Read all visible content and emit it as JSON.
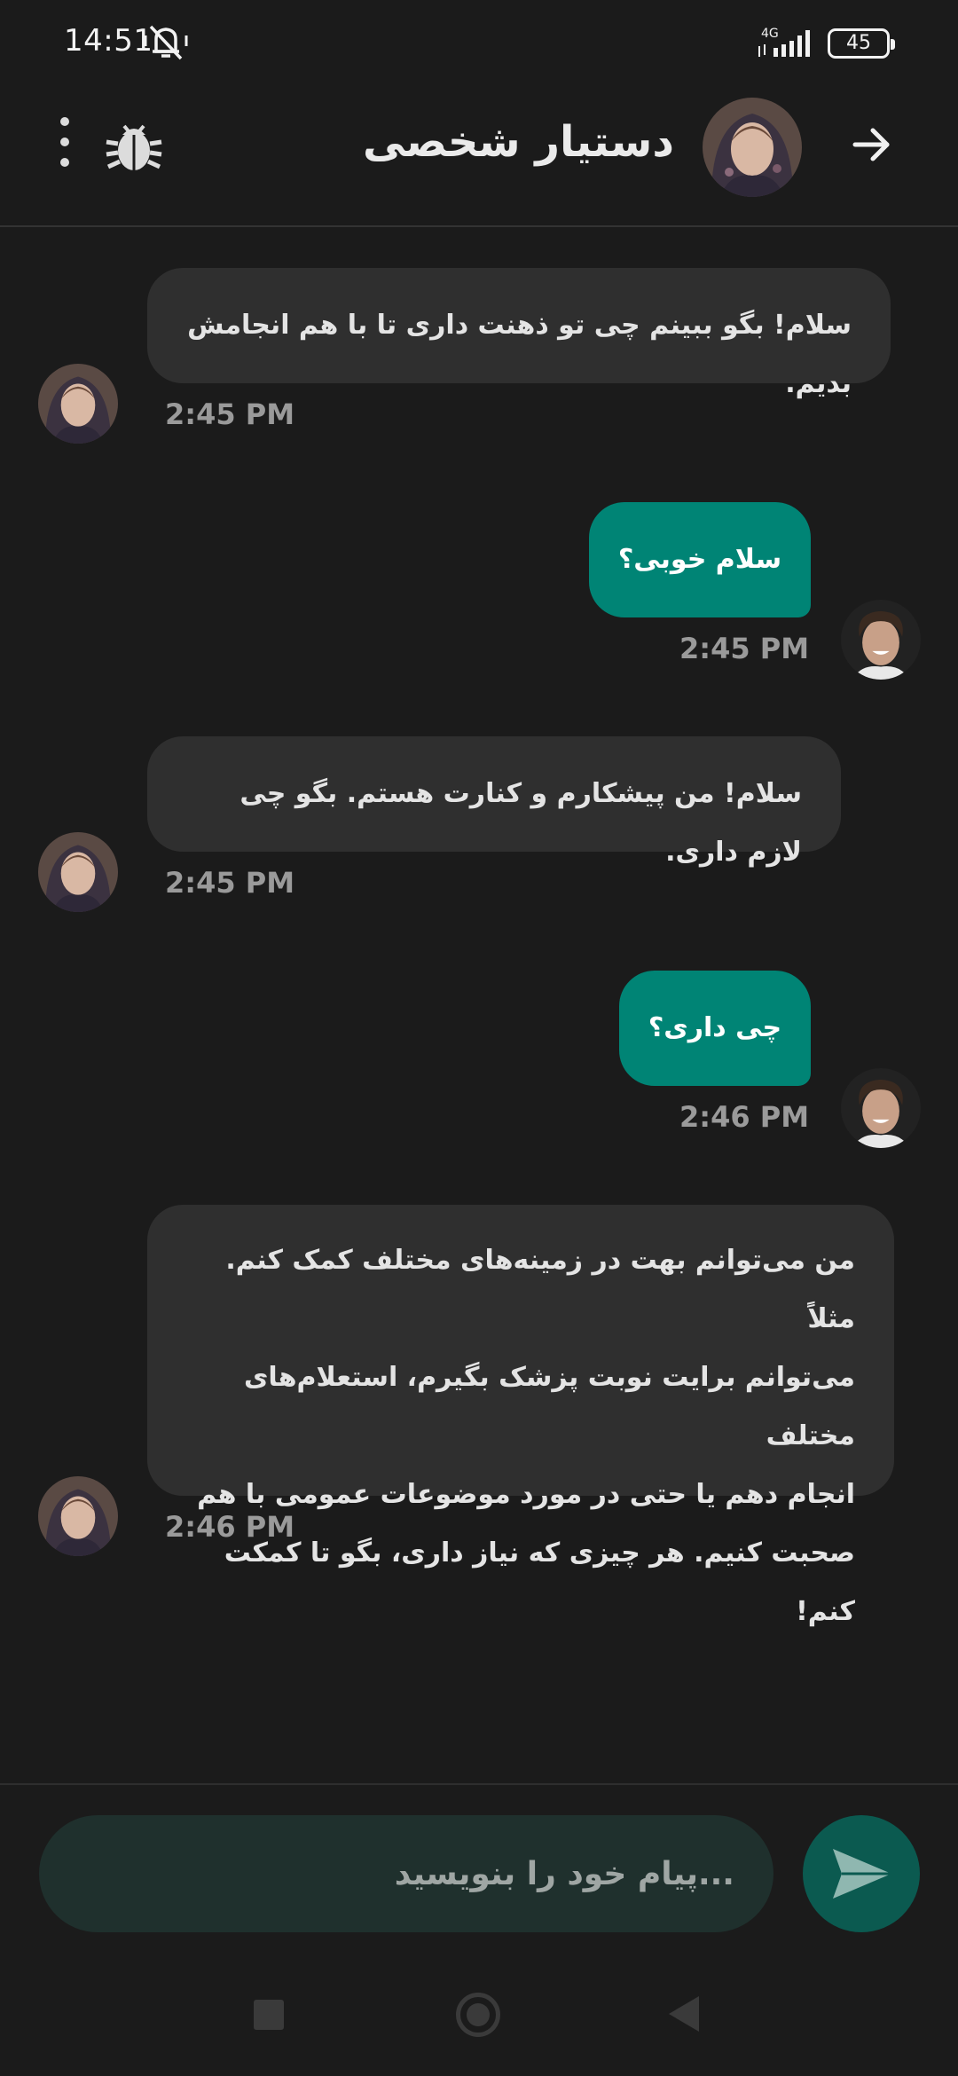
{
  "status": {
    "time": "14:51",
    "network": "4G",
    "battery": "45"
  },
  "header": {
    "title": "دستیار شخصی"
  },
  "messages": [
    {
      "from": "bot",
      "text": "سلام! بگو ببینم چی تو ذهنت داری تا با هم انجامش بدیم.",
      "time": "2:45 PM"
    },
    {
      "from": "user",
      "text": "سلام خوبی؟",
      "time": "2:45 PM"
    },
    {
      "from": "bot",
      "text": "سلام! من پیشکارم و کنارت هستم. بگو چی لازم داری.",
      "time": "2:45 PM"
    },
    {
      "from": "user",
      "text": "چی داری؟",
      "time": "2:46 PM"
    },
    {
      "from": "bot",
      "lines": [
        "من می‌توانم بهت در زمینه‌های مختلف کمک کنم. مثلاً",
        "می‌توانم برایت نوبت پزشک بگیرم، استعلام‌های مختلف",
        "انجام دهم یا حتی در مورد موضوعات عمومی با هم",
        "صحبت کنیم. هر چیزی که نیاز داری، بگو تا کمکت کنم!"
      ],
      "time": "2:46 PM"
    }
  ],
  "composer": {
    "placeholder": "...پیام خود را بنویسید"
  },
  "colors": {
    "background": "#1b1b1b",
    "bot_bubble": "#2f2f2f",
    "user_bubble": "#008475",
    "input_bg": "#1f302d",
    "send_bg": "#0b5a50"
  },
  "icons": [
    "mute-icon",
    "signal-icon",
    "battery-icon",
    "more-vert-icon",
    "bug-icon",
    "arrow-right-icon",
    "send-icon",
    "nav-recents-icon",
    "nav-home-icon",
    "nav-back-icon"
  ]
}
